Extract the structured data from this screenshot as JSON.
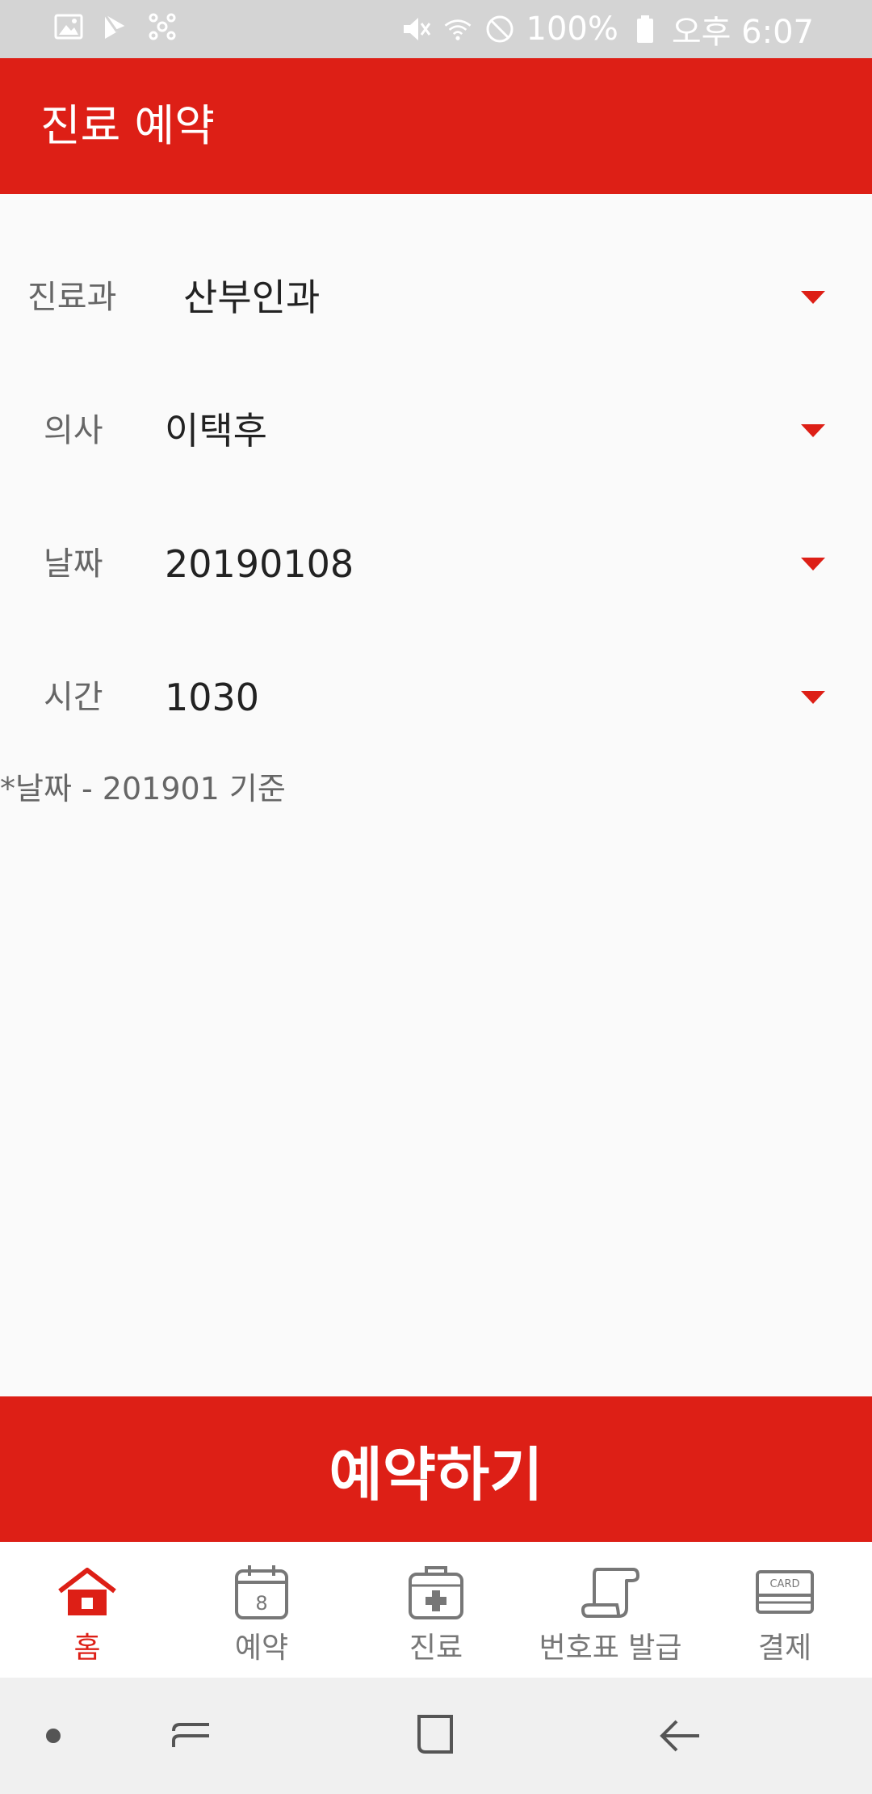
{
  "status_bar": {
    "battery": "100%",
    "time": "오후 6:07",
    "left_icons": [
      "image-icon",
      "play-store-icon",
      "network-icon"
    ],
    "right_icons": [
      "mute-icon",
      "wifi-icon",
      "no-disturb-icon",
      "battery-icon"
    ]
  },
  "app_bar": {
    "title": "진료 예약"
  },
  "form": {
    "department": {
      "label": "진료과",
      "value": "산부인과"
    },
    "doctor": {
      "label": "의사",
      "value": "이택후"
    },
    "date": {
      "label": "날짜",
      "value": "20190108"
    },
    "time": {
      "label": "시간",
      "value": "1030"
    }
  },
  "note": "*날짜 - 201901 기준",
  "reserve_button": "예약하기",
  "tabs": [
    {
      "label": "홈",
      "icon": "home-icon",
      "active": true
    },
    {
      "label": "예약",
      "icon": "calendar-icon",
      "active": false
    },
    {
      "label": "진료",
      "icon": "medical-kit-icon",
      "active": false
    },
    {
      "label": "번호표 발급",
      "icon": "ticket-icon",
      "active": false
    },
    {
      "label": "결제",
      "icon": "card-icon",
      "active": false
    }
  ],
  "card_icon_text": "CARD",
  "calendar_icon_text": "8",
  "colors": {
    "accent": "#dd1f16",
    "status_bar": "#d4d4d4",
    "background": "#fafafa"
  }
}
